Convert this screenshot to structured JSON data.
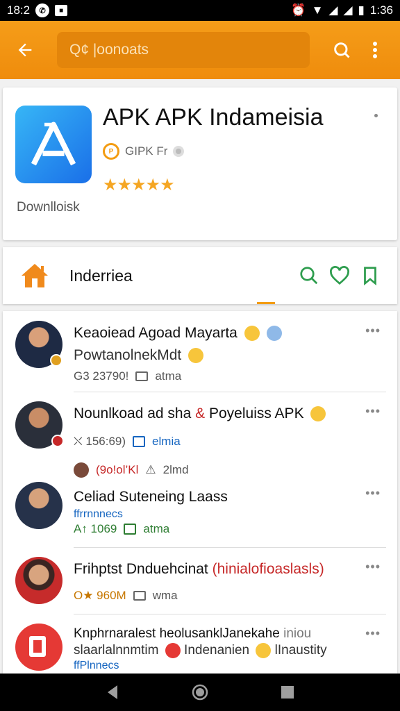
{
  "status_bar": {
    "time_left": "18:2",
    "time_right": "1:36",
    "icon_a": "whatsapp-icon",
    "icon_b": "notification-icon"
  },
  "app_bar": {
    "search_text": "Q¢ |oonoats"
  },
  "app": {
    "title": "APK APK  Indameisia",
    "meta": "GIPK Fr",
    "rating_stars": "★★★★★",
    "rating_value": 5,
    "downloads": "Downlloisk"
  },
  "nav": {
    "title": "Inderriea"
  },
  "items": [
    {
      "title": "Keaoiead Agoad Mayarta",
      "subtitle": "PowtanolnekMdt",
      "meta1": "G3  23790!",
      "meta2": "atma"
    },
    {
      "title": "Nounlkoad ad sha",
      "title_amp": "&",
      "title_end": "Poyeluiss APK",
      "meta1": "⛌ 156:69)",
      "meta2": "elmia",
      "meta3": "(9o!ol’Kl",
      "meta4": "2lmd"
    },
    {
      "title": "Celiad Suteneing Laass",
      "subtitle": "ffrrnnnecs",
      "meta1": "A↑ 1069",
      "meta2": "atma"
    },
    {
      "title": "Frihptst Dnduehcinat",
      "title_red": "(hinialofioaslasls)",
      "meta1": "O★ 960M",
      "meta2": "wma"
    },
    {
      "title": "Knphrnaralest heolusanklJanekahe",
      "title_end": "iniou",
      "subtitle": "slaarlalnnmtim",
      "subtitle_mid": "Indenanien",
      "subtitle_end": "lInaustity",
      "meta1": "ffPlnnecs"
    }
  ],
  "colors": {
    "accent": "#ef8c0c",
    "star": "#f5a623",
    "green_icon": "#2e9d4e",
    "link_blue": "#1565c0"
  }
}
